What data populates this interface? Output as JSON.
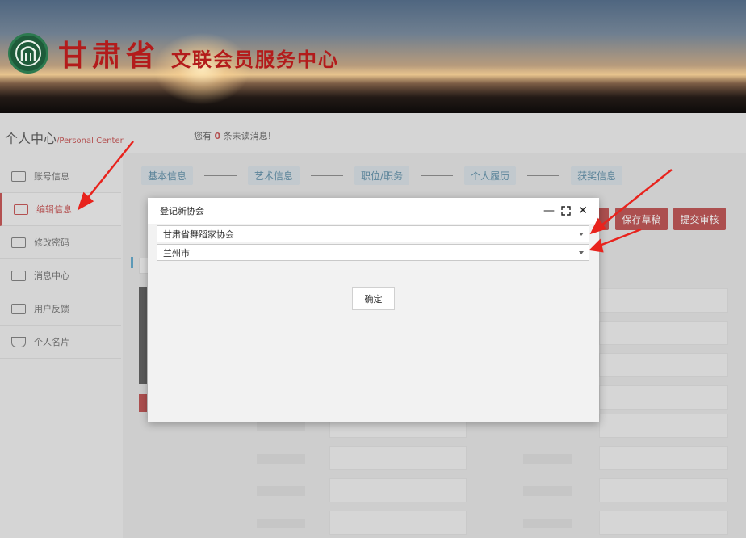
{
  "header": {
    "title": "甘肃省",
    "subtitle": "文联会员服务中心"
  },
  "personal_center": {
    "title": "个人中心",
    "title_en": "/Personal Center"
  },
  "notice": {
    "prefix": "您有",
    "count": "0",
    "suffix": "条未读消息!"
  },
  "sidebar": {
    "items": [
      {
        "label": "账号信息",
        "icon": "id-card-icon"
      },
      {
        "label": "编辑信息",
        "icon": "edit-card-icon",
        "active": true
      },
      {
        "label": "修改密码",
        "icon": "pencil-icon"
      },
      {
        "label": "消息中心",
        "icon": "message-icon"
      },
      {
        "label": "用户反馈",
        "icon": "feedback-icon"
      },
      {
        "label": "个人名片",
        "icon": "graduation-cap-icon"
      }
    ]
  },
  "steps": [
    "基本信息",
    "艺术信息",
    "职位/职务",
    "个人履历",
    "获奖信息"
  ],
  "actions": {
    "save_draft": "保存草稿",
    "submit_review": "提交审核"
  },
  "dialog": {
    "title": "登记新协会",
    "association_value": "甘肃省舞蹈家协会",
    "city_value": "兰州市",
    "confirm_label": "确定"
  },
  "colors": {
    "accent_red": "#a81a1a",
    "step_blue": "#2d6b8c"
  }
}
